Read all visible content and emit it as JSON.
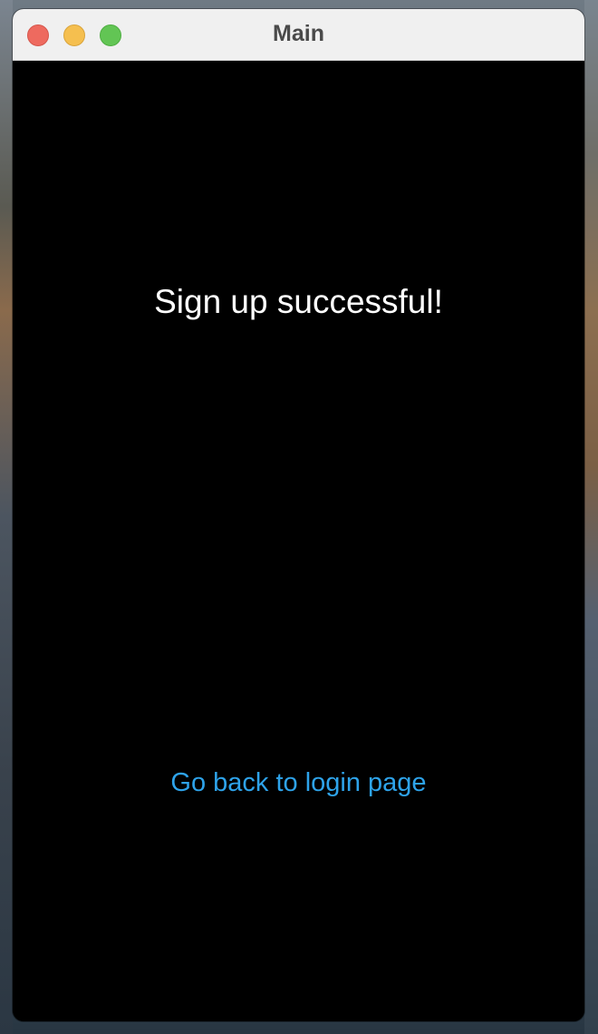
{
  "window": {
    "title": "Main"
  },
  "main": {
    "heading": "Sign up successful!",
    "back_link_label": "Go back to login page"
  },
  "colors": {
    "background": "#000000",
    "heading_text": "#ffffff",
    "link_text": "#2ea3ea",
    "titlebar": "#f0f0f0",
    "close": "#ee6a5f",
    "minimize": "#f5bf4f",
    "zoom": "#62c554"
  }
}
